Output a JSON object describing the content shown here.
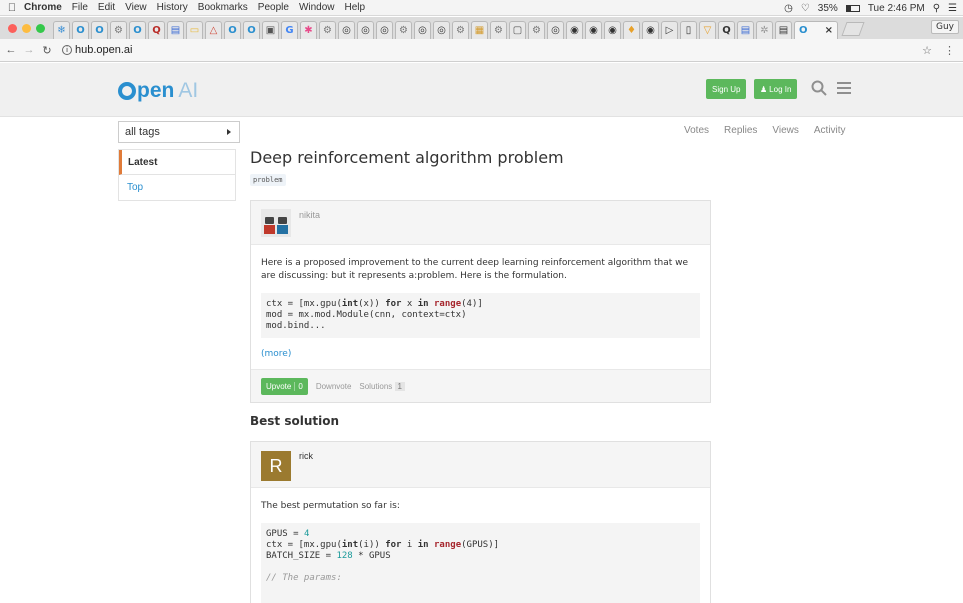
{
  "menubar": {
    "app": "Chrome",
    "items": [
      "File",
      "Edit",
      "View",
      "History",
      "Bookmarks",
      "People",
      "Window",
      "Help"
    ],
    "battery": "35%",
    "clock": "Tue 2:46 PM"
  },
  "browser": {
    "profile": "Guy",
    "active_tab_close": "×",
    "url": "hub.open.ai"
  },
  "site": {
    "logo_main": "pen",
    "logo_suffix": "AI",
    "signup_label": "Sign Up",
    "login_label": "Log In"
  },
  "sidebar": {
    "tags_select": "all tags",
    "nav": [
      {
        "label": "Latest"
      },
      {
        "label": "Top"
      }
    ]
  },
  "sort_links": [
    "Votes",
    "Replies",
    "Views",
    "Activity"
  ],
  "topic": {
    "title": "Deep reinforcement algorithm problem",
    "tag": "problem"
  },
  "question": {
    "author": "nikita",
    "text": "Here is a proposed improvement to the current deep learning reinforcement algorithm that we are discussing: but it represents a:problem. Here is the formulation.",
    "more_label": "(more)",
    "upvote_label": "Upvote",
    "upvote_count": "0",
    "downvote_label": "Downvote",
    "solutions_label": "Solutions",
    "solutions_count": "1"
  },
  "best_solution": {
    "heading": "Best solution",
    "author": "rick",
    "avatar_letter": "R",
    "text": "The best permutation so far is:"
  },
  "colors": {
    "brand_blue": "#2a8fcf",
    "green": "#5cb85c",
    "active_accent": "#e07b39"
  }
}
